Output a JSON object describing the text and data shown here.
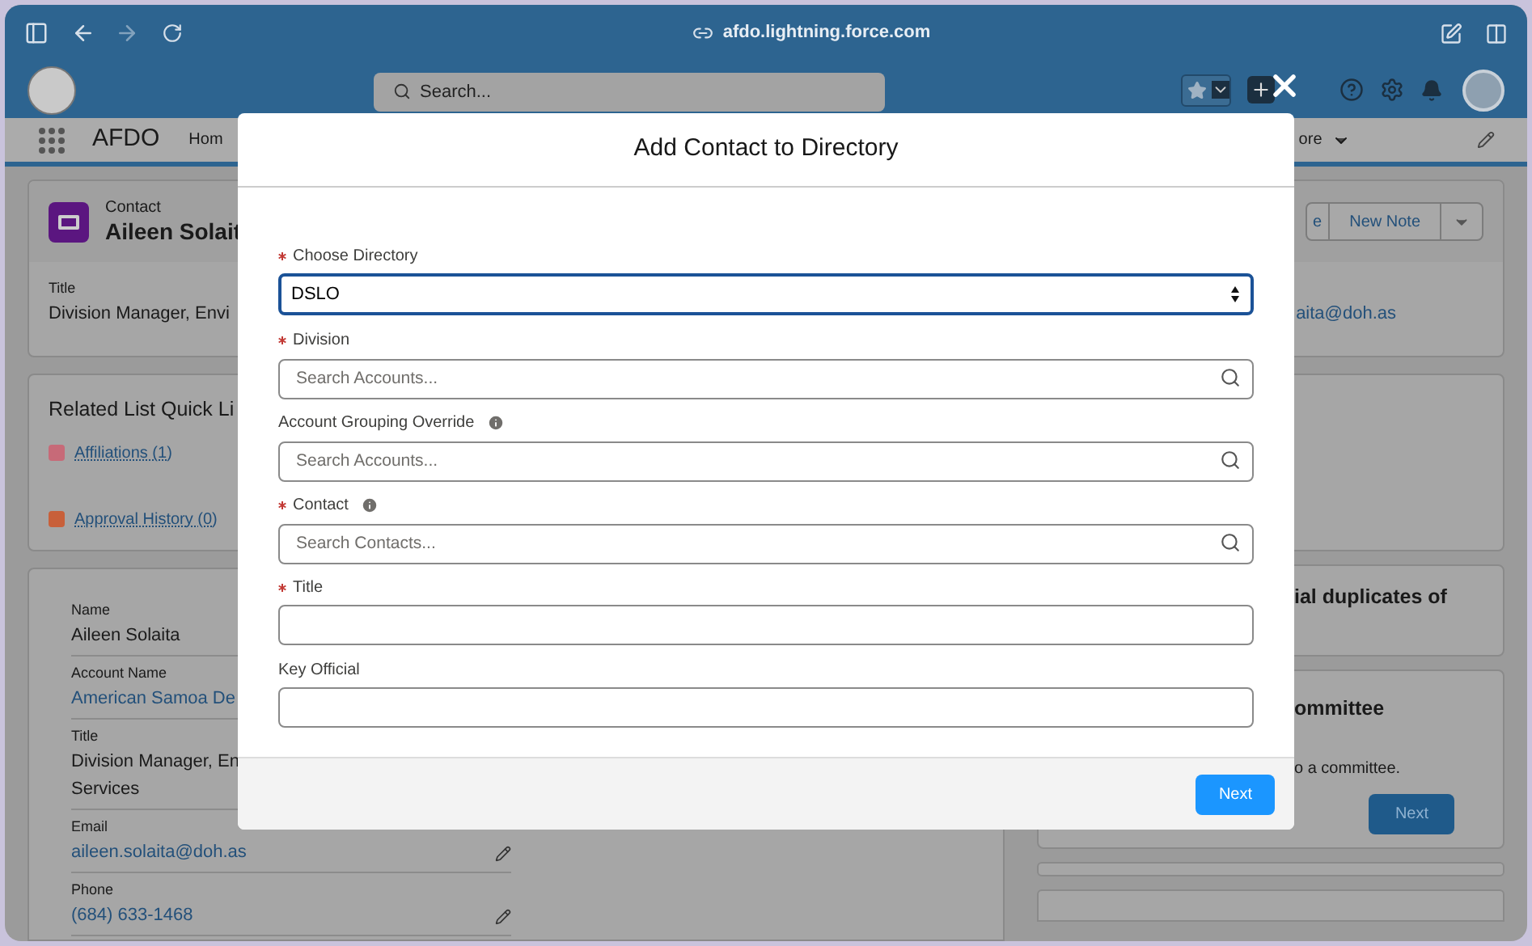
{
  "browser": {
    "url": "afdo.lightning.force.com"
  },
  "app_header": {
    "search_placeholder": "Search..."
  },
  "nav": {
    "app_name": "AFDO",
    "items": [
      {
        "label": "Hom",
        "menu": false
      },
      {
        "label": "ore",
        "menu": true
      }
    ]
  },
  "record": {
    "object_label": "Contact",
    "name": "Aileen Solait",
    "fields": [
      {
        "label": "Title",
        "value": "Division Manager, Envi",
        "link": false
      }
    ],
    "right_value": "aita@doh.as",
    "buttons": [
      {
        "label": "e"
      },
      {
        "label": "New Note"
      }
    ]
  },
  "related_list": {
    "title": "Related List Quick Li",
    "links": [
      {
        "label": "Affiliations (1)",
        "color": "#c76a78"
      },
      {
        "label": "Approval History (0)",
        "color": "#c8603a"
      }
    ]
  },
  "details": [
    {
      "label": "Name",
      "value": "Aileen Solaita",
      "link": false,
      "editable": false
    },
    {
      "label": "Account Name",
      "value": "American Samoa De",
      "link": true,
      "editable": false
    },
    {
      "label": "Title",
      "value": "Division Manager, En",
      "value2": "Services",
      "link": false,
      "editable": false
    },
    {
      "label": "Email",
      "value": "aileen.solaita@doh.as",
      "link": true,
      "editable": true
    },
    {
      "label": "Phone",
      "value": "(684) 633-1468",
      "link": true,
      "editable": true
    }
  ],
  "right_cards": [
    {
      "title": "ial duplicates of"
    },
    {
      "title": "ommittee",
      "text": "o a committee.",
      "button": "Next"
    }
  ],
  "modal": {
    "title": "Add Contact to Directory",
    "fields": [
      {
        "kind": "select",
        "label": "Choose Directory",
        "required": true,
        "info": false,
        "value": "DSLO"
      },
      {
        "kind": "lookup",
        "label": "Division",
        "required": true,
        "info": false,
        "placeholder": "Search Accounts..."
      },
      {
        "kind": "lookup",
        "label": "Account Grouping Override",
        "required": false,
        "info": true,
        "placeholder": "Search Accounts..."
      },
      {
        "kind": "lookup",
        "label": "Contact",
        "required": true,
        "info": true,
        "placeholder": "Search Contacts..."
      },
      {
        "kind": "text",
        "label": "Title",
        "required": true,
        "info": false
      },
      {
        "kind": "text",
        "label": "Key Official",
        "required": false,
        "info": false
      }
    ],
    "button": "Next"
  }
}
